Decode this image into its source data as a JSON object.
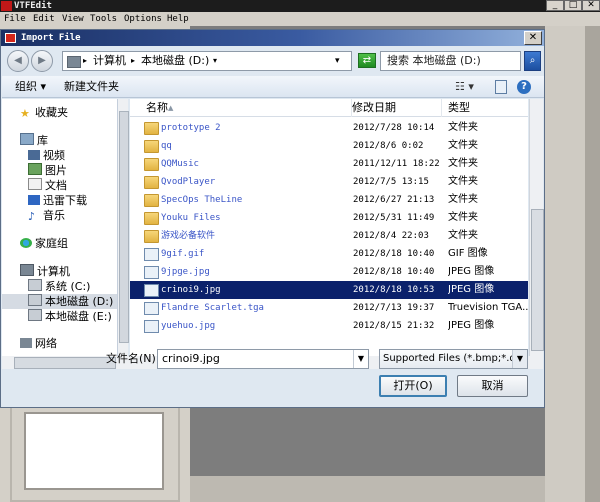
{
  "app": {
    "title": "VTFEdit",
    "menu": [
      "File",
      "Edit",
      "View",
      "Tools",
      "Options",
      "Help"
    ],
    "win_min": "_",
    "win_max": "□",
    "win_close": "✕"
  },
  "dialog": {
    "title": "Import File",
    "close": "✕",
    "address": {
      "segments": [
        "计算机",
        "本地磁盘 (D:)"
      ],
      "sep": "▸",
      "dropdown": "▾"
    },
    "search_placeholder": "搜索 本地磁盘 (D:)",
    "toolbar": {
      "organize": "组织 ▾",
      "new_folder": "新建文件夹"
    },
    "nav": {
      "favorites": "收藏夹",
      "library": "库",
      "library_items": [
        "视频",
        "图片",
        "文档",
        "迅雷下载",
        "音乐"
      ],
      "homegroup": "家庭组",
      "computer": "计算机",
      "drives": [
        "系统 (C:)",
        "本地磁盘 (D:)",
        "本地磁盘 (E:)"
      ],
      "network": "网络"
    },
    "columns": {
      "name": "名称",
      "date": "修改日期",
      "type": "类型"
    },
    "files": [
      {
        "name": "prototype 2",
        "date": "2012/7/28 10:14",
        "type": "文件夹",
        "kind": "folder"
      },
      {
        "name": "qq",
        "date": "2012/8/6 0:02",
        "type": "文件夹",
        "kind": "folder"
      },
      {
        "name": "QQMusic",
        "date": "2011/12/11 18:22",
        "type": "文件夹",
        "kind": "folder"
      },
      {
        "name": "QvodPlayer",
        "date": "2012/7/5 13:15",
        "type": "文件夹",
        "kind": "folder"
      },
      {
        "name": "SpecOps TheLine",
        "date": "2012/6/27 21:13",
        "type": "文件夹",
        "kind": "folder"
      },
      {
        "name": "Youku Files",
        "date": "2012/5/31 11:49",
        "type": "文件夹",
        "kind": "folder"
      },
      {
        "name": "游戏必备软件",
        "date": "2012/8/4 22:03",
        "type": "文件夹",
        "kind": "folder"
      },
      {
        "name": "9gif.gif",
        "date": "2012/8/18 10:40",
        "type": "GIF 图像",
        "kind": "image"
      },
      {
        "name": "9jpge.jpg",
        "date": "2012/8/18 10:40",
        "type": "JPEG 图像",
        "kind": "image"
      },
      {
        "name": "crinoi9.jpg",
        "date": "2012/8/18 10:53",
        "type": "JPEG 图像",
        "kind": "image",
        "selected": true
      },
      {
        "name": "Flandre Scarlet.tga",
        "date": "2012/7/13 19:37",
        "type": "Truevision TGA...",
        "kind": "image"
      },
      {
        "name": "yuehuo.jpg",
        "date": "2012/8/15 21:32",
        "type": "JPEG 图像",
        "kind": "image"
      }
    ],
    "filename_label": "文件名(N):",
    "filename_value": "crinoi9.jpg",
    "filetype_value": "Supported Files (*.bmp;*.dds",
    "open_label": "打开(O)",
    "cancel_label": "取消"
  },
  "colors": {
    "selection": "#0b216b",
    "file_name_text": "#3a55c7",
    "title_gradient_start": "#1a2f63"
  }
}
